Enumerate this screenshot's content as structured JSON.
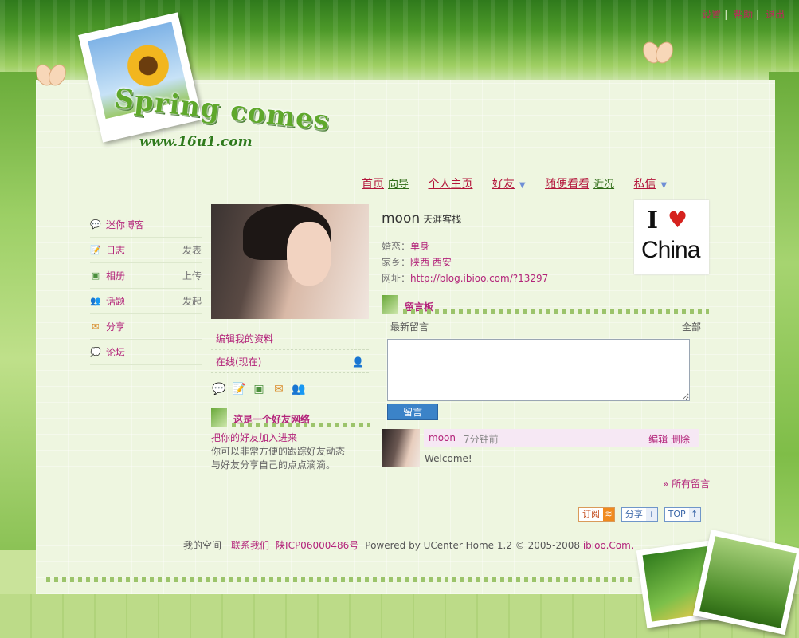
{
  "top_links": {
    "items": [
      "设置",
      "帮助",
      "退出"
    ]
  },
  "logo": {
    "title": "Spring comes",
    "url": "www.16u1.com"
  },
  "nav": {
    "items": [
      {
        "label": "首页",
        "sub": "向导"
      },
      {
        "label": "个人主页"
      },
      {
        "label": "好友",
        "dropdown": true
      },
      {
        "label": "随便看看",
        "sub": "近况"
      },
      {
        "label": "私信",
        "dropdown": true
      }
    ]
  },
  "sidebar": {
    "items": [
      {
        "icon": "speech-bubble-icon",
        "label": "迷你博客",
        "action": ""
      },
      {
        "icon": "blog-edit-icon",
        "label": "日志",
        "action": "发表"
      },
      {
        "icon": "album-icon",
        "label": "相册",
        "action": "上传"
      },
      {
        "icon": "topic-users-icon",
        "label": "话题",
        "action": "发起"
      },
      {
        "icon": "share-icon",
        "label": "分享",
        "action": ""
      },
      {
        "icon": "forum-bubbles-icon",
        "label": "论坛",
        "action": ""
      }
    ]
  },
  "profile": {
    "edit_link": "编辑我的资料",
    "online": "在线(现在)",
    "quick_icons": [
      "speech-bubble-icon",
      "blog-edit-icon",
      "album-icon",
      "share-icon",
      "topic-users-icon"
    ]
  },
  "friend_box": {
    "title": "这是一个好友网络",
    "link": "把你的好友加入进来",
    "desc_line1": "你可以非常方便的跟踪好友动态",
    "desc_line2": "与好友分享自己的点点滴滴。"
  },
  "user": {
    "name": "moon",
    "tagline": "天涯客栈",
    "marital_label": "婚恋：",
    "marital_value": "单身",
    "hometown_label": "家乡：",
    "hometown_value": "陕西 西安",
    "site_label": "网址：",
    "site_value": "http://blog.ibioo.com/?13297"
  },
  "badge": {
    "i": "I",
    "heart": "♥",
    "text": "China"
  },
  "guestbook": {
    "title": "留言板",
    "latest": "最新留言",
    "all": "全部",
    "submit": "留言",
    "textarea_value": ""
  },
  "message": {
    "author": "moon",
    "time": "7分钟前",
    "edit": "编辑",
    "delete": "删除",
    "body": "Welcome!"
  },
  "all_messages": "» 所有留言",
  "feed_buttons": {
    "subscribe": "订阅",
    "share": "分享",
    "top": "TOP"
  },
  "footer": {
    "my_space": "我的空间",
    "contact": "联系我们",
    "icp": "陕ICP06000486号",
    "powered": "Powered by UCenter Home 1.2 © 2005-2008",
    "brand": "ibioo.Com."
  },
  "colors": {
    "accent_pink": "#b3247a",
    "nav_red": "#b3143a",
    "green": "#2e6b15",
    "button_blue": "#3b83c8"
  }
}
